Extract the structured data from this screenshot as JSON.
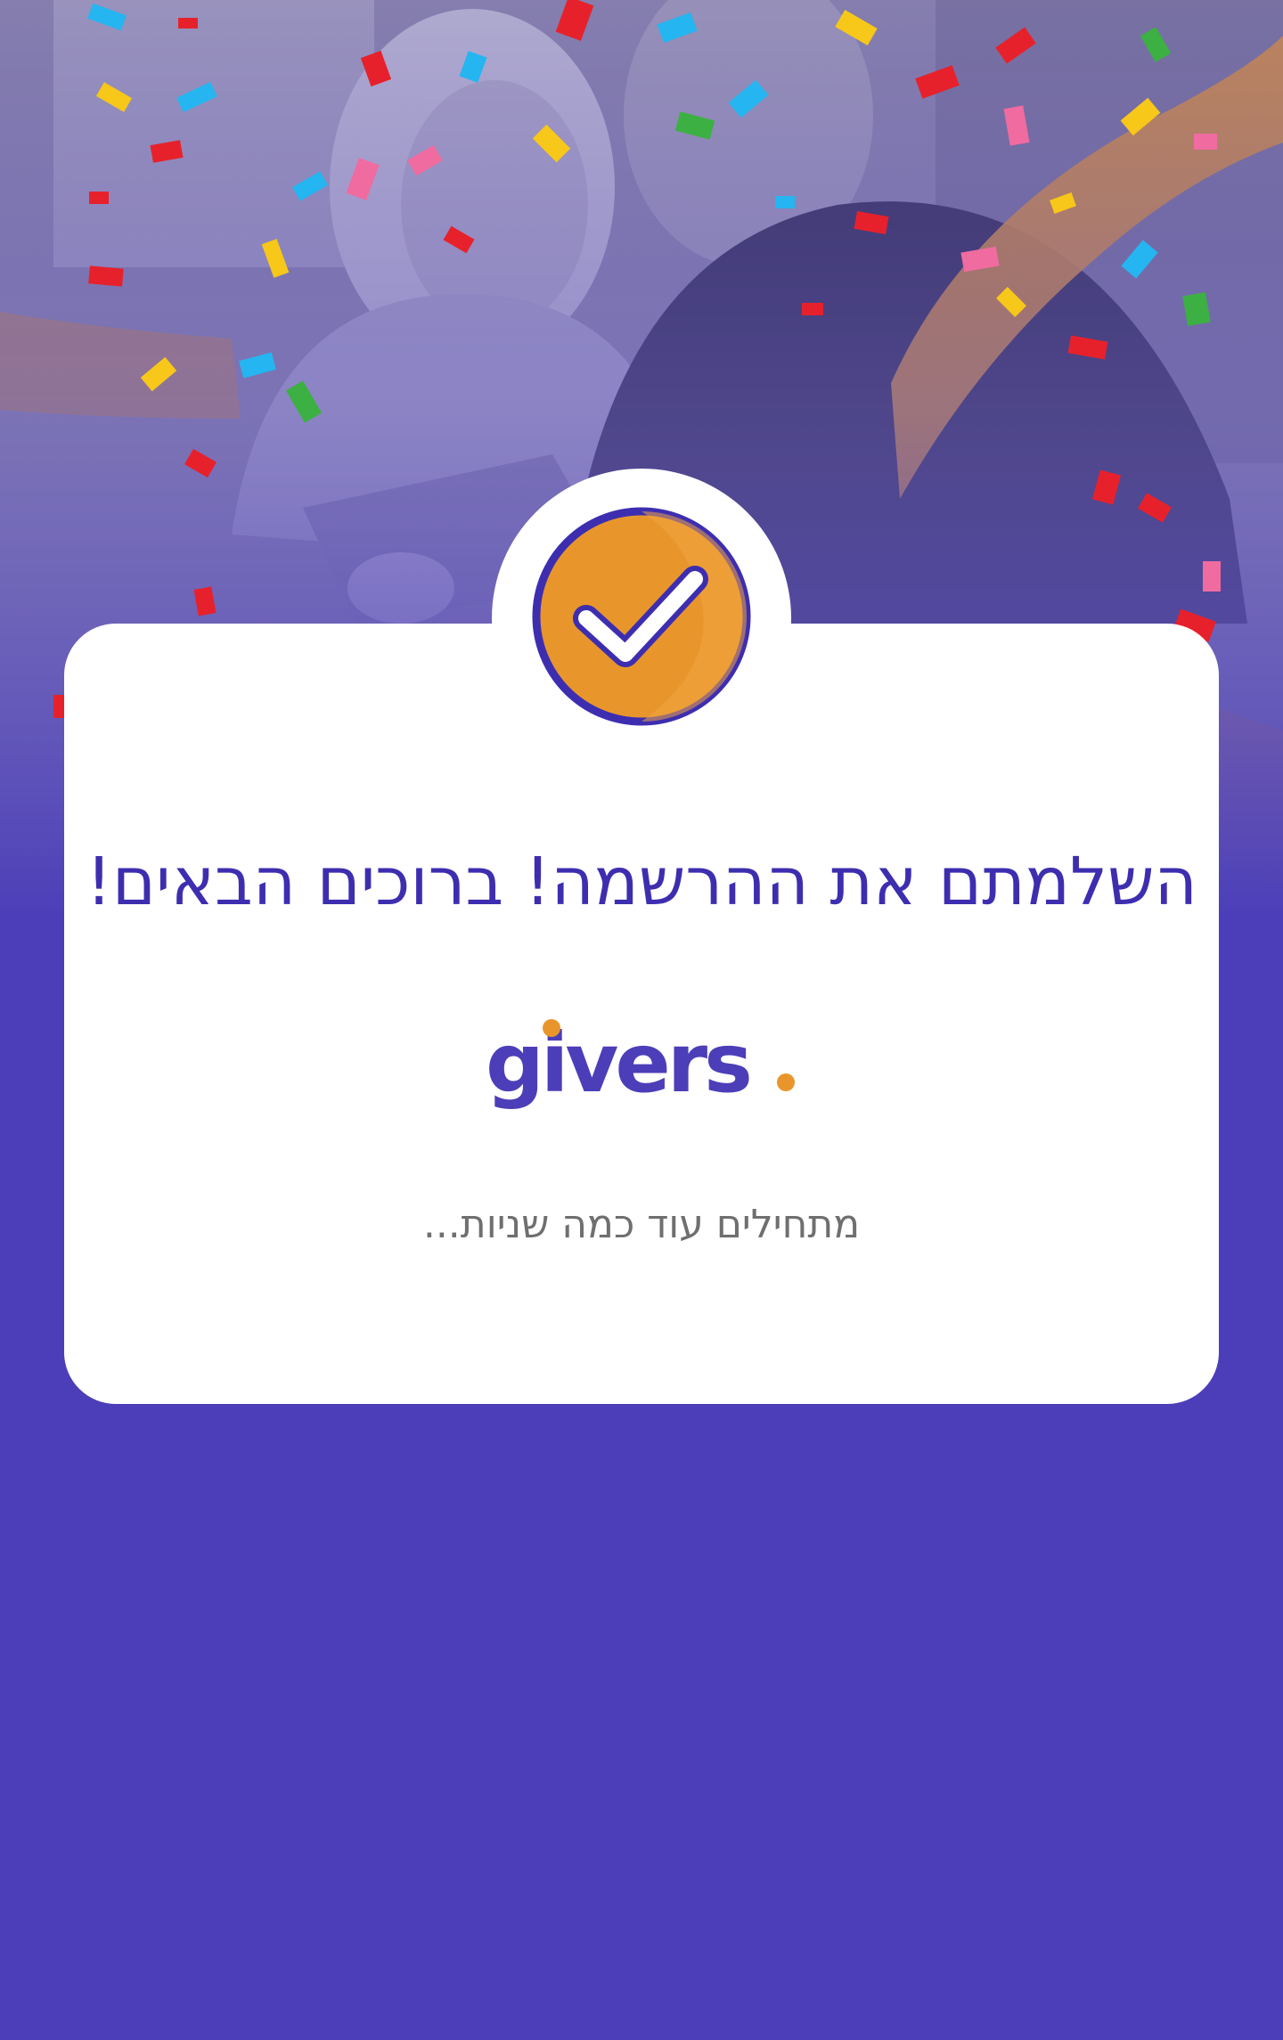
{
  "page": {
    "background_color": "#4c3eb8",
    "card_color": "#ffffff"
  },
  "hero": {
    "image_description_icon": "celebration-photo-confetti",
    "accent_color": "#e8962c"
  },
  "badge": {
    "icon": "checkmark-icon",
    "fill_color": "#e8962c",
    "ring_color": "#3d2eb0"
  },
  "card": {
    "title": "השלמתם את ההרשמה! ברוכים הבאים!",
    "logo_text": "givers",
    "logo_dot": ".",
    "subtitle": "מתחילים עוד כמה שניות..."
  },
  "colors": {
    "title": "#3d2eb0",
    "logo": "#4c3eb8",
    "logo_accent": "#e8962c",
    "subtitle": "#6f6f6f"
  }
}
